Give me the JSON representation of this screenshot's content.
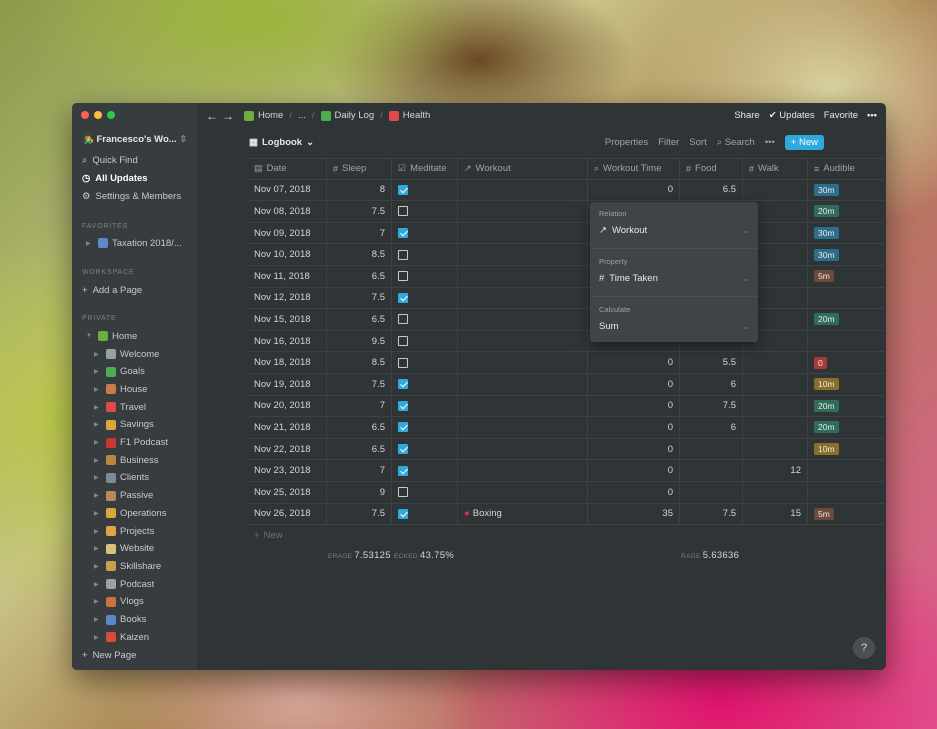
{
  "window": {
    "colors": {
      "bg": "#2f3437",
      "sidebar": "#373c3f",
      "accent": "#2eaadc"
    }
  },
  "sidebar": {
    "workspace": "Francesco's Wo...",
    "items": [
      {
        "label": "Quick Find",
        "icon": "search-icon"
      },
      {
        "label": "All Updates",
        "icon": "clock-icon"
      },
      {
        "label": "Settings & Members",
        "icon": "gear-icon"
      }
    ],
    "favorites_label": "FAVORITES",
    "favorites": [
      {
        "label": "Taxation 2018/..."
      }
    ],
    "workspace_label": "WORKSPACE",
    "add_page": "Add a Page",
    "private_label": "PRIVATE",
    "home": "Home",
    "pages": [
      {
        "label": "Welcome",
        "color": "#9aa0a4"
      },
      {
        "label": "Goals",
        "color": "#4cae4f"
      },
      {
        "label": "House",
        "color": "#c77d4a"
      },
      {
        "label": "Travel",
        "color": "#e24a4a"
      },
      {
        "label": "Savings",
        "color": "#d9a83a"
      },
      {
        "label": "F1 Podcast",
        "color": "#c8382e"
      },
      {
        "label": "Business",
        "color": "#b8873a"
      },
      {
        "label": "Clients",
        "color": "#7d8b95"
      },
      {
        "label": "Passive",
        "color": "#b88a5a"
      },
      {
        "label": "Operations",
        "color": "#d9a83a"
      },
      {
        "label": "Projects",
        "color": "#e0a24a"
      },
      {
        "label": "Website",
        "color": "#d6c27a"
      },
      {
        "label": "Skillshare",
        "color": "#c9a04a"
      },
      {
        "label": "Podcast",
        "color": "#9aa0a4"
      },
      {
        "label": "Vlogs",
        "color": "#c8743a"
      },
      {
        "label": "Books",
        "color": "#5a88c9"
      },
      {
        "label": "Kaizen",
        "color": "#d94a3a"
      }
    ],
    "new_page": "New Page"
  },
  "topbar": {
    "crumbs": [
      "Home",
      "...",
      "Daily Log",
      "Health"
    ],
    "share": "Share",
    "updates": "Updates",
    "favorite": "Favorite",
    "more": "•••"
  },
  "view": {
    "title": "Logbook",
    "properties": "Properties",
    "filter": "Filter",
    "sort": "Sort",
    "search": "Search",
    "more": "•••",
    "new": "New"
  },
  "table": {
    "headers": [
      {
        "label": "Date",
        "icon": "calendar-icon"
      },
      {
        "label": "Sleep",
        "icon": "#"
      },
      {
        "label": "Meditate",
        "icon": "checkbox-icon"
      },
      {
        "label": "Workout",
        "icon": "↗"
      },
      {
        "label": "Workout Time",
        "icon": "search-icon"
      },
      {
        "label": "Food",
        "icon": "#"
      },
      {
        "label": "Walk",
        "icon": "#"
      },
      {
        "label": "Audible",
        "icon": "≡"
      }
    ],
    "rows": [
      {
        "date": "Nov 07, 2018",
        "sleep": "8",
        "med": true,
        "workout": "",
        "wt": "0",
        "food": "6.5",
        "walk": "",
        "aud": "30m",
        "tag": "#2d6e8a"
      },
      {
        "date": "Nov 08, 2018",
        "sleep": "7.5",
        "med": false,
        "workout": "",
        "wt": "",
        "food": "",
        "walk": "",
        "aud": "20m",
        "tag": "#2f6d5a"
      },
      {
        "date": "Nov 09, 2018",
        "sleep": "7",
        "med": true,
        "workout": "",
        "wt": "",
        "food": "",
        "walk": "",
        "aud": "30m",
        "tag": "#2d6e8a"
      },
      {
        "date": "Nov 10, 2018",
        "sleep": "8.5",
        "med": false,
        "workout": "",
        "wt": "",
        "food": "",
        "walk": "",
        "aud": "30m",
        "tag": "#2d6e8a"
      },
      {
        "date": "Nov 11, 2018",
        "sleep": "6.5",
        "med": false,
        "workout": "",
        "wt": "",
        "food": "",
        "walk": "",
        "aud": "5m",
        "tag": "#6b4a3a"
      },
      {
        "date": "Nov 12, 2018",
        "sleep": "7.5",
        "med": true,
        "workout": "",
        "wt": "",
        "food": "",
        "walk": "",
        "aud": "",
        "tag": ""
      },
      {
        "date": "Nov 15, 2018",
        "sleep": "6.5",
        "med": false,
        "workout": "",
        "wt": "",
        "food": "",
        "walk": "",
        "aud": "20m",
        "tag": "#2f6d5a"
      },
      {
        "date": "Nov 16, 2018",
        "sleep": "9.5",
        "med": false,
        "workout": "",
        "wt": "",
        "food": "",
        "walk": "",
        "aud": "",
        "tag": ""
      },
      {
        "date": "Nov 18, 2018",
        "sleep": "8.5",
        "med": false,
        "workout": "",
        "wt": "0",
        "food": "5.5",
        "walk": "",
        "aud": "0",
        "tag": "#a83a3a"
      },
      {
        "date": "Nov 19, 2018",
        "sleep": "7.5",
        "med": true,
        "workout": "",
        "wt": "0",
        "food": "6",
        "walk": "",
        "aud": "10m",
        "tag": "#8a6f2a"
      },
      {
        "date": "Nov 20, 2018",
        "sleep": "7",
        "med": true,
        "workout": "",
        "wt": "0",
        "food": "7.5",
        "walk": "",
        "aud": "20m",
        "tag": "#2f6d5a"
      },
      {
        "date": "Nov 21, 2018",
        "sleep": "6.5",
        "med": true,
        "workout": "",
        "wt": "0",
        "food": "6",
        "walk": "",
        "aud": "20m",
        "tag": "#2f6d5a"
      },
      {
        "date": "Nov 22, 2018",
        "sleep": "6.5",
        "med": true,
        "workout": "",
        "wt": "0",
        "food": "",
        "walk": "",
        "aud": "10m",
        "tag": "#8a6f2a"
      },
      {
        "date": "Nov 23, 2018",
        "sleep": "7",
        "med": true,
        "workout": "",
        "wt": "0",
        "food": "",
        "walk": "12",
        "aud": "",
        "tag": ""
      },
      {
        "date": "Nov 25, 2018",
        "sleep": "9",
        "med": false,
        "workout": "",
        "wt": "0",
        "food": "",
        "walk": "",
        "aud": "",
        "tag": ""
      },
      {
        "date": "Nov 26, 2018",
        "sleep": "7.5",
        "med": true,
        "workout": "Boxing",
        "wt": "35",
        "food": "7.5",
        "walk": "15",
        "aud": "5m",
        "tag": "#6b4a3a"
      }
    ],
    "new_row": "New",
    "calc": {
      "sleep_label": "ERAGE",
      "sleep_val": "7.53125",
      "med_label": "ECKED",
      "med_val": "43.75%",
      "wt_label": "RAGE",
      "wt_val": "5.63636"
    }
  },
  "popover": {
    "relation_label": "Relation",
    "relation_val": "Workout",
    "property_label": "Property",
    "property_val": "Time Taken",
    "calc_label": "Calculate",
    "calc_val": "Sum"
  },
  "help": "?"
}
